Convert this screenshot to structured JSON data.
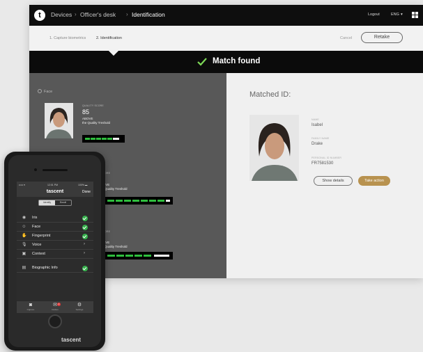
{
  "topbar": {
    "logo_letter": "t",
    "breadcrumb": [
      "Devices",
      "Officer's desk",
      "Identification"
    ],
    "logout_label": "Logout",
    "language_label": "ENG"
  },
  "steps": {
    "step1": "1. Capture biometrics",
    "step2": "2. Identification",
    "cancel_label": "Cancel",
    "retake_label": "Retake"
  },
  "banner": {
    "text": "Match found",
    "accent": "#7ed957"
  },
  "quality": {
    "section_label": "Face",
    "score_label": "QUALITY SCORE",
    "score_value": "85",
    "above_label": "ABOVE",
    "threshold_text": "the Quality Treshold",
    "partial_block2_a": "IVE",
    "partial_block2_b": "Quality Treshold",
    "partial_block3_a": "IVE",
    "partial_block3_b": "Quality Treshold",
    "partial_score_label": "ORE"
  },
  "matched": {
    "title": "Matched ID:",
    "name_label": "NAME",
    "name_value": "Isabel",
    "family_label": "FAMILY NAME",
    "family_value": "Drake",
    "pid_label": "PERSONAL ID NUMBER",
    "pid_value": "FR7581530",
    "show_details_label": "Show details",
    "take_action_label": "Take action",
    "take_action_color": "#b8924f"
  },
  "phone": {
    "status_carrier": "••••• ▾",
    "status_time": "12:01 PM",
    "status_battery": "100% ▬",
    "app_name": "tascent",
    "done_label": "Done",
    "segment_a": "Identify",
    "segment_b": "Enroll",
    "modalities": [
      {
        "label": "Iris",
        "icon": "eye-icon",
        "state": "ok"
      },
      {
        "label": "Face",
        "icon": "person-icon",
        "state": "ok"
      },
      {
        "label": "Fingerprint",
        "icon": "hand-icon",
        "state": "ok"
      },
      {
        "label": "Voice",
        "icon": "microphone-icon",
        "state": "chevron"
      },
      {
        "label": "Context",
        "icon": "context-icon",
        "state": "chevron"
      }
    ],
    "biographic_label": "Biographic Info",
    "tabs": [
      {
        "label": "Capture",
        "icon": "camera-icon"
      },
      {
        "label": "Outbox",
        "icon": "outbox-icon",
        "badge": "2"
      },
      {
        "label": "Settings",
        "icon": "gear-icon"
      }
    ],
    "brand_text": "tascent"
  }
}
